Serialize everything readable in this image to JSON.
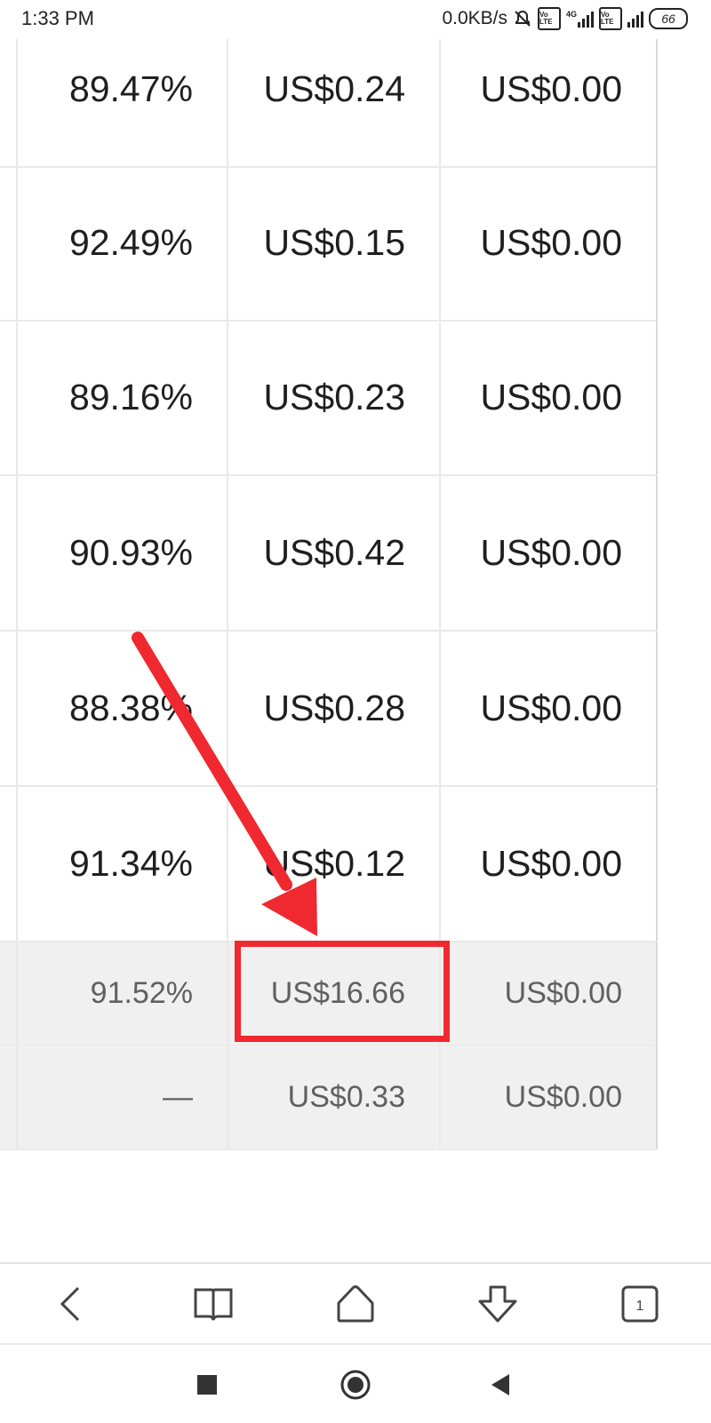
{
  "status_bar": {
    "time": "1:33 PM",
    "net_speed": "0.0KB/s",
    "volte_1": "Vo LTE",
    "network_type": "4G",
    "volte_2": "Vo LTE",
    "battery": "66",
    "icons": [
      "notifications-muted-icon",
      "volte-icon",
      "signal-icon",
      "volte-icon",
      "signal-icon",
      "battery-icon"
    ]
  },
  "table": {
    "rows": [
      {
        "rate": "89.47%",
        "earnings": "US$0.24",
        "other": "US$0.00"
      },
      {
        "rate": "92.49%",
        "earnings": "US$0.15",
        "other": "US$0.00"
      },
      {
        "rate": "89.16%",
        "earnings": "US$0.23",
        "other": "US$0.00"
      },
      {
        "rate": "90.93%",
        "earnings": "US$0.42",
        "other": "US$0.00"
      },
      {
        "rate": "88.38%",
        "earnings": "US$0.28",
        "other": "US$0.00"
      },
      {
        "rate": "91.34%",
        "earnings": "US$0.12",
        "other": "US$0.00"
      }
    ],
    "totals": [
      {
        "rate": "91.52%",
        "earnings": "US$16.66",
        "other": "US$0.00"
      },
      {
        "rate": "—",
        "earnings": "US$0.33",
        "other": "US$0.00"
      }
    ]
  },
  "annotation": {
    "color": "#f0282f",
    "highlighted_value": "US$16.66"
  },
  "browser_toolbar": {
    "tab_count": "1",
    "icons": [
      "back-icon",
      "bookmarks-icon",
      "home-icon",
      "download-icon",
      "tabs-icon"
    ]
  },
  "nav_bar": {
    "icons": [
      "recents-icon",
      "home-icon",
      "back-icon"
    ]
  }
}
